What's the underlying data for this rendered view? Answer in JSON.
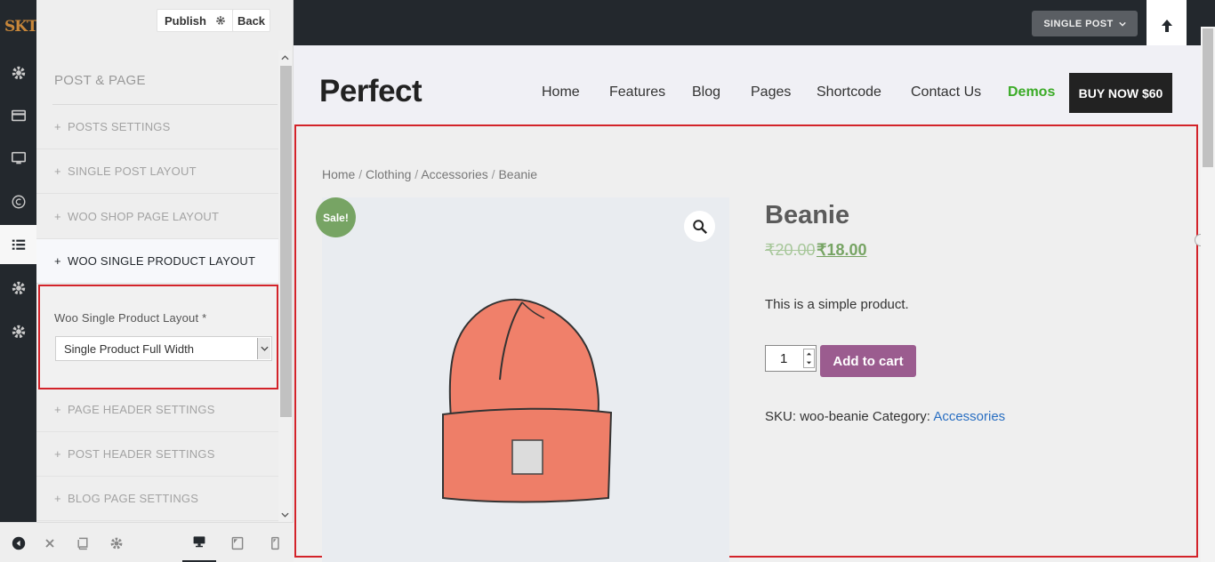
{
  "rail": {
    "logo": "SKT",
    "icons": [
      "gear-icon",
      "card-icon",
      "monitor-icon",
      "copyright-icon",
      "list-icon",
      "gear-icon",
      "gear-icon"
    ]
  },
  "topbar": {
    "publish_label": "Publish",
    "back_label": "Back"
  },
  "panel": {
    "title": "POST & PAGE",
    "sections_top": [
      "POSTS SETTINGS",
      "SINGLE POST LAYOUT",
      "WOO SHOP PAGE LAYOUT",
      "WOO SINGLE PRODUCT LAYOUT"
    ],
    "control": {
      "label": "Woo Single Product Layout *",
      "selected": "Single Product Full Width"
    },
    "sections_bottom": [
      "PAGE HEADER SETTINGS",
      "POST HEADER SETTINGS",
      "BLOG PAGE SETTINGS"
    ],
    "plus": "+"
  },
  "preview": {
    "single_post_label": "SINGLE POST",
    "site_title": "Perfect",
    "nav": [
      "Home",
      "Features",
      "Blog",
      "Pages",
      "Shortcode",
      "Contact Us",
      "Demos"
    ],
    "buy_label": "BUY NOW $60",
    "breadcrumb": [
      "Home",
      "Clothing",
      "Accessories",
      "Beanie"
    ],
    "breadcrumb_sep": "/",
    "sale_badge": "Sale!",
    "product": {
      "title": "Beanie",
      "old_price": "₹20.00",
      "new_price": "₹18.00",
      "description": "This is a simple product.",
      "quantity": "1",
      "add_to_cart": "Add to cart",
      "sku_label": "SKU:",
      "sku": "woo-beanie",
      "category_label": "Category:",
      "category": "Accessories"
    }
  },
  "colors": {
    "rail_bg": "#23282d",
    "highlight_red": "#d3232a",
    "sale_green": "#77a464",
    "demos_green": "#3bab27",
    "cart_purple": "#9b5c8f",
    "link_blue": "#2a6fc2",
    "beanie": "#f0806a"
  }
}
